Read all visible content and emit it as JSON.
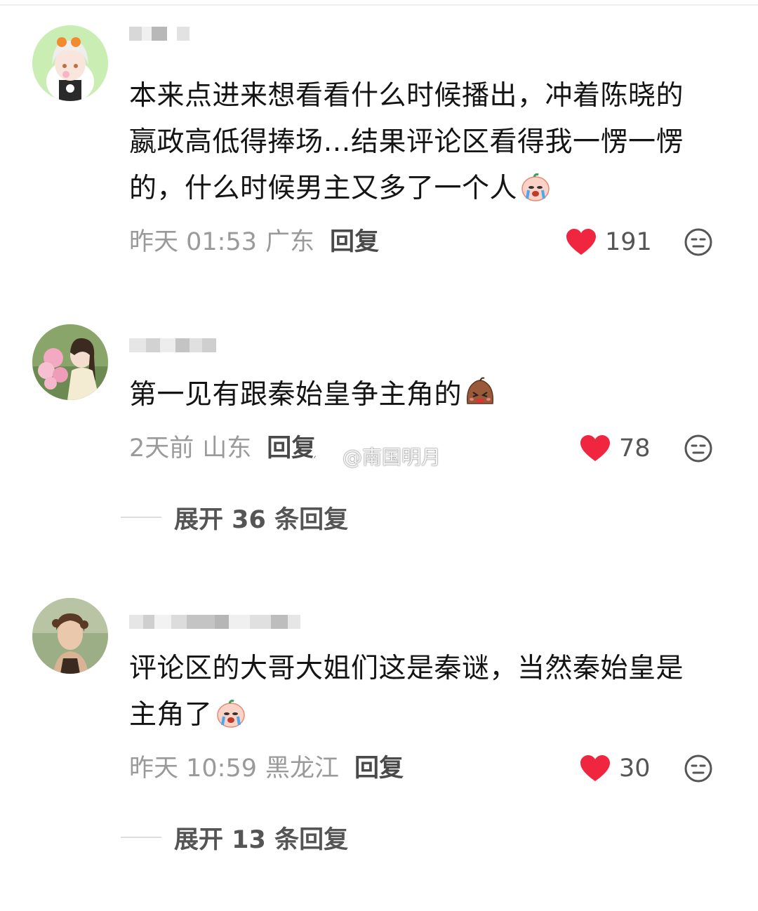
{
  "comments": [
    {
      "text": "本来点进来想看看什么时候播出，冲着陈晓的嬴政高低得捧场…结果评论区看得我一愣一愣的，什么时候男主又多了一个人",
      "lines": [
        "本来点进来想看看什么时候播出，冲着陈晓的",
        "嬴政高低得捧场…结果评论区看得我一愣一愣",
        "的，什么时候男主又多了一个人"
      ],
      "emoji": "crying-peach-emoji",
      "time": "昨天 01:53",
      "location": "广东",
      "reply_label": "回复",
      "likes": "191"
    },
    {
      "text": "第一见有跟秦始皇争主角的",
      "lines": [
        "第一见有跟秦始皇争主角的"
      ],
      "emoji": "angry-potato-emoji",
      "time": "2天前",
      "location": "山东",
      "reply_label": "回复",
      "likes": "78",
      "expand_label": "展开 36 条回复"
    },
    {
      "text": "评论区的大哥大姐们这是秦谜，当然秦始皇是主角了",
      "lines": [
        "评论区的大哥大姐们这是秦谜，当然秦始皇是",
        "主角了"
      ],
      "emoji": "crying-peach-emoji",
      "time": "昨天 10:59",
      "location": "黑龙江",
      "reply_label": "回复",
      "likes": "30",
      "expand_label": "展开 13 条回复"
    }
  ],
  "watermark": "@南国明月",
  "colors": {
    "like": "#f02640",
    "meta": "#9a9a9a",
    "text": "#141414"
  }
}
